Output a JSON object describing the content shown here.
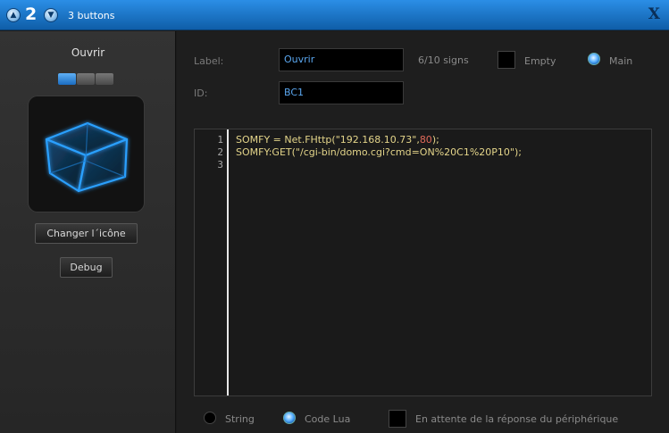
{
  "titlebar": {
    "number": "2",
    "title": "3 buttons",
    "close": "X"
  },
  "left": {
    "title": "Ouvrir",
    "change_icon_label": "Changer l´icône",
    "debug_label": "Debug"
  },
  "form": {
    "label_caption": "Label:",
    "label_value": "Ouvrir",
    "signs": "6/10 signs",
    "empty_label": "Empty",
    "main_label": "Main",
    "id_caption": "ID:",
    "id_value": "BC1"
  },
  "editor": {
    "line_numbers": [
      "1",
      "2",
      "3"
    ],
    "line1": {
      "a": "SOMFY = Net.FHttp(",
      "b": "\"192.168.10.73\"",
      "c": ",",
      "d": "80",
      "e": ");"
    },
    "line2": {
      "a": "SOMFY:GET(",
      "b": "\"/cgi-bin/domo.cgi?cmd=ON%20C1%20P10\"",
      "c": ");"
    }
  },
  "bottom": {
    "string_label": "String",
    "codelua_label": "Code Lua",
    "waiting_label": "En attente de la réponse du périphérique"
  },
  "colors": {
    "accent": "#1f7fd6",
    "code": "#e4d58a",
    "number": "#e06a5a",
    "field_text": "#5aa6ee"
  }
}
